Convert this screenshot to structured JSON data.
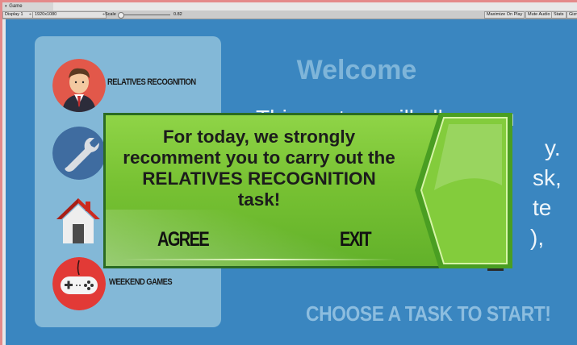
{
  "editor": {
    "tab_label": "Game",
    "display_select": "Display 1",
    "resolution_select": "1920x1080",
    "scale_label": "Scale",
    "scale_value": "0.82",
    "buttons": [
      "Maximize On Play",
      "Mute Audio",
      "Stats",
      "Gizmos"
    ]
  },
  "side_menu": {
    "items": [
      {
        "label": "RELATIVES RECOGNITION",
        "icon": "man-avatar-icon",
        "color": "#e2584a"
      },
      {
        "label": "",
        "icon": "wrench-icon",
        "color": "#3f6ca0"
      },
      {
        "label": "",
        "icon": "house-icon",
        "color": "#cc2a1f"
      },
      {
        "label": "WEEKEND GAMES",
        "icon": "gamepad-icon",
        "color": "#e23a36"
      }
    ]
  },
  "main": {
    "welcome": "Welcome",
    "bg_lines": [
      "This system will allow you",
      "y.",
      "sk,",
      "te",
      "),"
    ],
    "choose_task": "CHOOSE A TASK TO START!"
  },
  "dialog": {
    "message_lines": [
      "For today, we strongly",
      "recomment you to carry out the",
      "RELATIVES RECOGNITION",
      "task!"
    ],
    "agree_label": "AGREE",
    "exit_label": "EXIT"
  },
  "colors": {
    "game_bg": "#3a86c0",
    "panel_bg": "#83b8d7",
    "dialog_green": "#78c233",
    "dialog_border": "#2b6b22"
  }
}
